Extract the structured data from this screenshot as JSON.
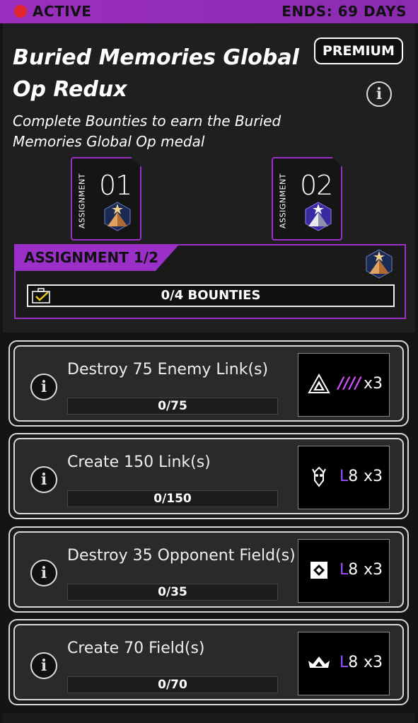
{
  "status": {
    "label": "ACTIVE",
    "ends": "ENDS: 69 DAYS"
  },
  "header": {
    "title": "Buried Memories Global Op Redux",
    "badge": "PREMIUM",
    "description": "Complete Bounties to earn the Buried Memories Global Op medal"
  },
  "assignments": [
    {
      "label": "ASSIGNMENT",
      "number": "01"
    },
    {
      "label": "ASSIGNMENT",
      "number": "02"
    }
  ],
  "panel": {
    "tab": "ASSIGNMENT 1/2",
    "progress": "0/4 BOUNTIES"
  },
  "bounties": [
    {
      "title": "Destroy 75 Enemy Link(s)",
      "progress": "0/75",
      "reward_icon": "triangle-badge-icon",
      "reward_level": "////",
      "reward_qty": "x3"
    },
    {
      "title": "Create 150 Link(s)",
      "progress": "0/150",
      "reward_icon": "bot-icon",
      "reward_level_prefix": "L",
      "reward_level_num": "8",
      "reward_qty": "x3"
    },
    {
      "title": "Destroy 35 Opponent Field(s)",
      "progress": "0/35",
      "reward_icon": "diamond-badge-icon",
      "reward_level_prefix": "L",
      "reward_level_num": "8",
      "reward_qty": "x3"
    },
    {
      "title": "Create 70 Field(s)",
      "progress": "0/70",
      "reward_icon": "wing-badge-icon",
      "reward_level_prefix": "L",
      "reward_level_num": "8",
      "reward_qty": "x3"
    }
  ],
  "colors": {
    "accent": "#9b30c9",
    "status_red": "#e0252b",
    "panel_bg": "#1f1f1f"
  }
}
